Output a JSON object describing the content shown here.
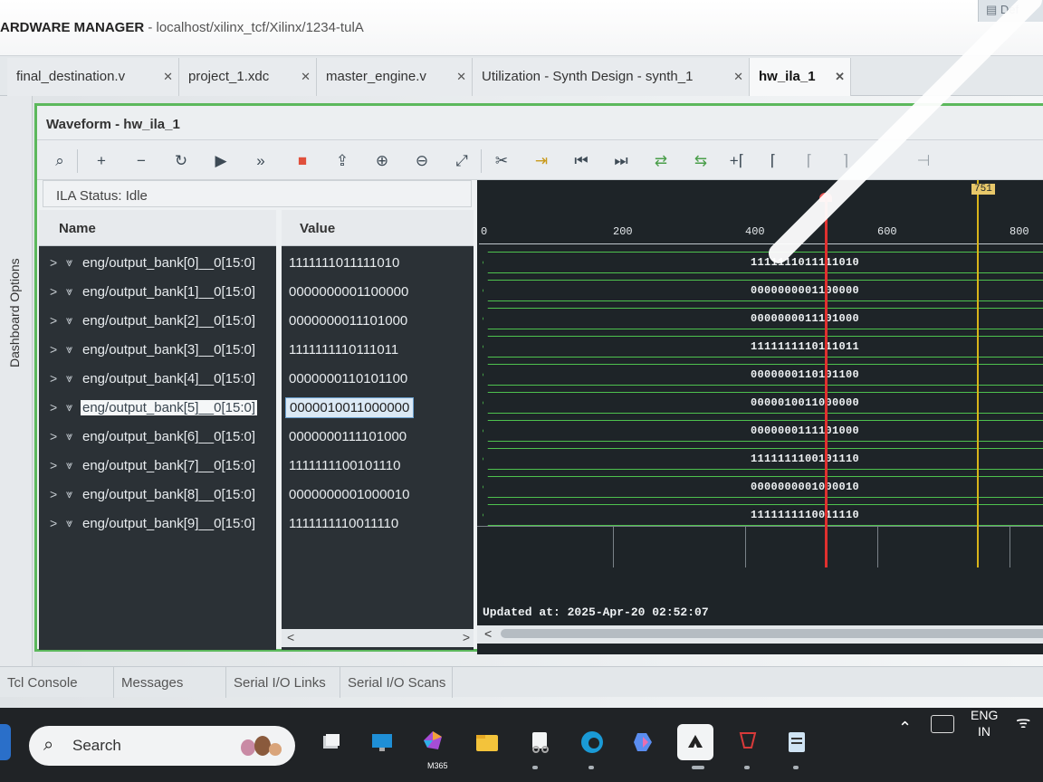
{
  "window": {
    "title_bold": "ARDWARE MANAGER",
    "title_path": " - localhost/xilinx_tcf/Xilinx/1234-tulA",
    "top_right_button": "Def"
  },
  "doc_tabs": [
    {
      "label": "final_destination.v",
      "active": false
    },
    {
      "label": "project_1.xdc",
      "active": false
    },
    {
      "label": "master_engine.v",
      "active": false
    },
    {
      "label": "Utilization - Synth Design - synth_1",
      "active": false
    },
    {
      "label": "hw_ila_1",
      "active": true
    }
  ],
  "left_strip": {
    "label": "Dashboard Options"
  },
  "waveform": {
    "title": "Waveform - hw_ila_1",
    "ila_status": "ILA Status:  Idle",
    "name_header": "Name",
    "value_header": "Value",
    "updated_at": "Updated at: 2025-Apr-20 02:52:07",
    "ruler_labels": [
      "0",
      "200",
      "400",
      "600",
      "800"
    ],
    "yellow_cursor_label": "751",
    "selected_row": 5,
    "signals": [
      {
        "name": "eng/output_bank[0]__0[15:0]",
        "value": "1111111011111010"
      },
      {
        "name": "eng/output_bank[1]__0[15:0]",
        "value": "0000000001100000"
      },
      {
        "name": "eng/output_bank[2]__0[15:0]",
        "value": "0000000011101000"
      },
      {
        "name": "eng/output_bank[3]__0[15:0]",
        "value": "1111111110111011"
      },
      {
        "name": "eng/output_bank[4]__0[15:0]",
        "value": "0000000110101100"
      },
      {
        "name": "eng/output_bank[5]__0[15:0]",
        "value": "0000010011000000"
      },
      {
        "name": "eng/output_bank[6]__0[15:0]",
        "value": "0000000111101000"
      },
      {
        "name": "eng/output_bank[7]__0[15:0]",
        "value": "1111111100101110"
      },
      {
        "name": "eng/output_bank[8]__0[15:0]",
        "value": "0000000001000010"
      },
      {
        "name": "eng/output_bank[9]__0[15:0]",
        "value": "1111111110011110"
      }
    ]
  },
  "toolbar": {
    "icons": [
      "search-icon",
      "add-icon",
      "remove-icon",
      "refresh-icon",
      "run-trigger-icon",
      "run-immediate-icon",
      "stop-icon",
      "export-icon",
      "zoom-in-icon",
      "zoom-out-icon",
      "zoom-fit-icon",
      "cut-icon",
      "go-to-cursor-icon",
      "go-to-start-icon",
      "go-to-end-icon",
      "add-marker-icon",
      "previous-marker-icon",
      "next-marker-icon",
      "previous-transition-icon",
      "next-transition-icon",
      "swap-cursors-icon",
      "snap-icon"
    ]
  },
  "bottom_tabs": [
    "Tcl Console",
    "Messages",
    "Serial I/O Links",
    "Serial I/O Scans"
  ],
  "taskbar": {
    "search_placeholder": "Search",
    "apps": [
      "file-explorer-icon",
      "desktop-icon",
      "m365-icon",
      "folder-icon",
      "snipping-tool-icon",
      "edge-icon",
      "copilot-icon",
      "vivado-icon",
      "red-app-icon",
      "notepad-icon"
    ],
    "m365_label": "M365",
    "lang_line1": "ENG",
    "lang_line2": "IN"
  }
}
